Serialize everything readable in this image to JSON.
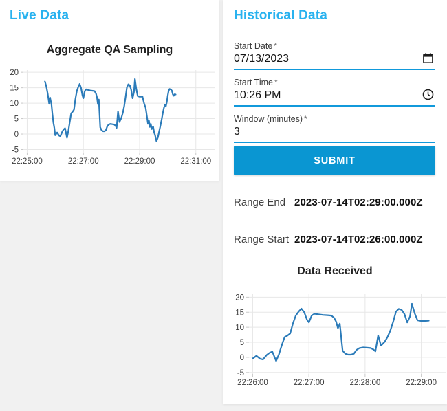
{
  "page": {
    "background": "#f1f1f1",
    "card_background": "#ffffff",
    "accent_heading_color": "#29b2ef",
    "primary_color": "#0a96d2",
    "underline_color": "#1199db",
    "line_color": "#2b7bb9"
  },
  "live_panel": {
    "title": "Live Data"
  },
  "historical_panel": {
    "title": "Historical Data",
    "fields": [
      {
        "label": "Start Date",
        "required_marker": "*",
        "value": "07/13/2023",
        "icon": "calendar-icon"
      },
      {
        "label": "Start Time",
        "required_marker": "*",
        "value": "10:26 PM",
        "icon": "clock-icon"
      },
      {
        "label": "Window (minutes)",
        "required_marker": "*",
        "value": "3",
        "icon": null
      }
    ],
    "submit_label": "SUBMIT",
    "results": [
      {
        "label": "Range End",
        "value": "2023-07-14T02:29:00.000Z"
      },
      {
        "label": "Range Start",
        "value": "2023-07-14T02:26:00.000Z"
      }
    ]
  },
  "chart_data": [
    {
      "id": "live",
      "type": "line",
      "title": "Aggregate QA Sampling",
      "xlabel": "",
      "ylabel": "",
      "t0": "22:25:00",
      "x_ticks": [
        {
          "t": 0,
          "label": "22:25:00"
        },
        {
          "t": 120,
          "label": "22:27:00"
        },
        {
          "t": 240,
          "label": "22:29:00"
        },
        {
          "t": 360,
          "label": "22:31:00"
        }
      ],
      "x_range_seconds": [
        -8,
        400
      ],
      "y_ticks": [
        -5,
        0,
        5,
        10,
        15,
        20
      ],
      "y_range": [
        -6,
        20.7
      ],
      "grid": true,
      "legend": false,
      "series": [
        {
          "name": "Aggregate QA Sampling",
          "color": "#2b7bb9",
          "points": [
            [
              38,
              17.0
            ],
            [
              41,
              15.4
            ],
            [
              44,
              13.0
            ],
            [
              47,
              9.8
            ],
            [
              49,
              11.8
            ],
            [
              52,
              9.5
            ],
            [
              54,
              6.5
            ],
            [
              56,
              3.8
            ],
            [
              58,
              2.0
            ],
            [
              60,
              -0.4
            ],
            [
              64,
              0.5
            ],
            [
              68,
              -0.5
            ],
            [
              71,
              -0.7
            ],
            [
              75,
              0.8
            ],
            [
              78,
              1.5
            ],
            [
              81,
              1.9
            ],
            [
              85,
              -1.2
            ],
            [
              88,
              1.0
            ],
            [
              91,
              4.0
            ],
            [
              94,
              6.7
            ],
            [
              97,
              7.2
            ],
            [
              100,
              7.9
            ],
            [
              103,
              11.3
            ],
            [
              106,
              13.9
            ],
            [
              109,
              15.2
            ],
            [
              112,
              16.2
            ],
            [
              115,
              15.0
            ],
            [
              118,
              12.5
            ],
            [
              120,
              11.6
            ],
            [
              123,
              13.9
            ],
            [
              126,
              14.5
            ],
            [
              130,
              14.3
            ],
            [
              135,
              14.1
            ],
            [
              140,
              14.0
            ],
            [
              144,
              13.9
            ],
            [
              147,
              13.1
            ],
            [
              149,
              11.9
            ],
            [
              151,
              9.7
            ],
            [
              153,
              11.2
            ],
            [
              156,
              2.2
            ],
            [
              159,
              1.2
            ],
            [
              162,
              0.9
            ],
            [
              165,
              0.9
            ],
            [
              168,
              1.2
            ],
            [
              171,
              2.5
            ],
            [
              174,
              3.1
            ],
            [
              178,
              3.3
            ],
            [
              182,
              3.2
            ],
            [
              186,
              3.1
            ],
            [
              189,
              2.6
            ],
            [
              191,
              2.0
            ],
            [
              194,
              7.3
            ],
            [
              197,
              3.9
            ],
            [
              201,
              5.2
            ],
            [
              204,
              6.8
            ],
            [
              207,
              8.9
            ],
            [
              210,
              11.8
            ],
            [
              213,
              15.2
            ],
            [
              216,
              16.1
            ],
            [
              219,
              15.8
            ],
            [
              222,
              14.4
            ],
            [
              225,
              11.6
            ],
            [
              228,
              13.6
            ],
            [
              230,
              17.8
            ],
            [
              233,
              14.6
            ],
            [
              236,
              12.3
            ],
            [
              240,
              12.1
            ],
            [
              244,
              12.1
            ],
            [
              246,
              12.2
            ],
            [
              248,
              11.0
            ],
            [
              250,
              9.7
            ],
            [
              253,
              8.5
            ],
            [
              256,
              5.3
            ],
            [
              258,
              3.3
            ],
            [
              260,
              4.3
            ],
            [
              262,
              2.3
            ],
            [
              264,
              3.3
            ],
            [
              266,
              1.6
            ],
            [
              269,
              2.4
            ],
            [
              271,
              0.6
            ],
            [
              273,
              -0.4
            ],
            [
              276,
              -2.3
            ],
            [
              279,
              -1.1
            ],
            [
              281,
              0.3
            ],
            [
              284,
              2.4
            ],
            [
              287,
              4.6
            ],
            [
              289,
              6.4
            ],
            [
              292,
              8.5
            ],
            [
              294,
              9.4
            ],
            [
              296,
              8.9
            ],
            [
              298,
              10.3
            ],
            [
              300,
              12.4
            ],
            [
              302,
              14.0
            ],
            [
              304,
              14.6
            ],
            [
              307,
              14.4
            ],
            [
              309,
              14.0
            ],
            [
              311,
              12.8
            ],
            [
              313,
              12.4
            ],
            [
              315,
              12.9
            ],
            [
              317,
              12.8
            ]
          ]
        }
      ]
    },
    {
      "id": "received",
      "type": "line",
      "title": "Data Received",
      "xlabel": "",
      "ylabel": "",
      "t0": "22:26:00",
      "x_ticks": [
        {
          "t": 0,
          "label": "22:26:00"
        },
        {
          "t": 60,
          "label": "22:27:00"
        },
        {
          "t": 120,
          "label": "22:28:00"
        },
        {
          "t": 180,
          "label": "22:29:00"
        }
      ],
      "x_range_seconds": [
        -4,
        206
      ],
      "y_ticks": [
        -5,
        0,
        5,
        10,
        15,
        20
      ],
      "y_range": [
        -5.5,
        21
      ],
      "grid": true,
      "legend": false,
      "series": [
        {
          "name": "Data Received",
          "color": "#2b7bb9",
          "points": [
            [
              0,
              -0.4
            ],
            [
              4,
              0.5
            ],
            [
              8,
              -0.5
            ],
            [
              11,
              -0.7
            ],
            [
              15,
              0.8
            ],
            [
              18,
              1.5
            ],
            [
              21,
              1.9
            ],
            [
              25,
              -1.2
            ],
            [
              28,
              1.0
            ],
            [
              31,
              4.0
            ],
            [
              34,
              6.7
            ],
            [
              37,
              7.2
            ],
            [
              40,
              7.9
            ],
            [
              43,
              11.3
            ],
            [
              46,
              13.9
            ],
            [
              49,
              15.2
            ],
            [
              52,
              16.2
            ],
            [
              55,
              15.0
            ],
            [
              58,
              12.5
            ],
            [
              60,
              11.6
            ],
            [
              63,
              13.9
            ],
            [
              66,
              14.5
            ],
            [
              70,
              14.3
            ],
            [
              75,
              14.1
            ],
            [
              80,
              14.0
            ],
            [
              84,
              13.9
            ],
            [
              87,
              13.1
            ],
            [
              89,
              11.9
            ],
            [
              91,
              9.7
            ],
            [
              93,
              11.2
            ],
            [
              96,
              2.2
            ],
            [
              99,
              1.2
            ],
            [
              102,
              0.9
            ],
            [
              105,
              0.9
            ],
            [
              108,
              1.2
            ],
            [
              111,
              2.5
            ],
            [
              114,
              3.1
            ],
            [
              118,
              3.3
            ],
            [
              122,
              3.2
            ],
            [
              126,
              3.1
            ],
            [
              129,
              2.6
            ],
            [
              131,
              2.0
            ],
            [
              134,
              7.3
            ],
            [
              137,
              3.9
            ],
            [
              141,
              5.2
            ],
            [
              144,
              6.8
            ],
            [
              147,
              8.9
            ],
            [
              150,
              11.8
            ],
            [
              153,
              15.2
            ],
            [
              156,
              16.1
            ],
            [
              159,
              15.8
            ],
            [
              162,
              14.4
            ],
            [
              165,
              11.6
            ],
            [
              168,
              13.6
            ],
            [
              170,
              17.8
            ],
            [
              173,
              14.6
            ],
            [
              176,
              12.3
            ],
            [
              180,
              12.1
            ],
            [
              184,
              12.1
            ],
            [
              188,
              12.2
            ]
          ]
        }
      ]
    }
  ]
}
